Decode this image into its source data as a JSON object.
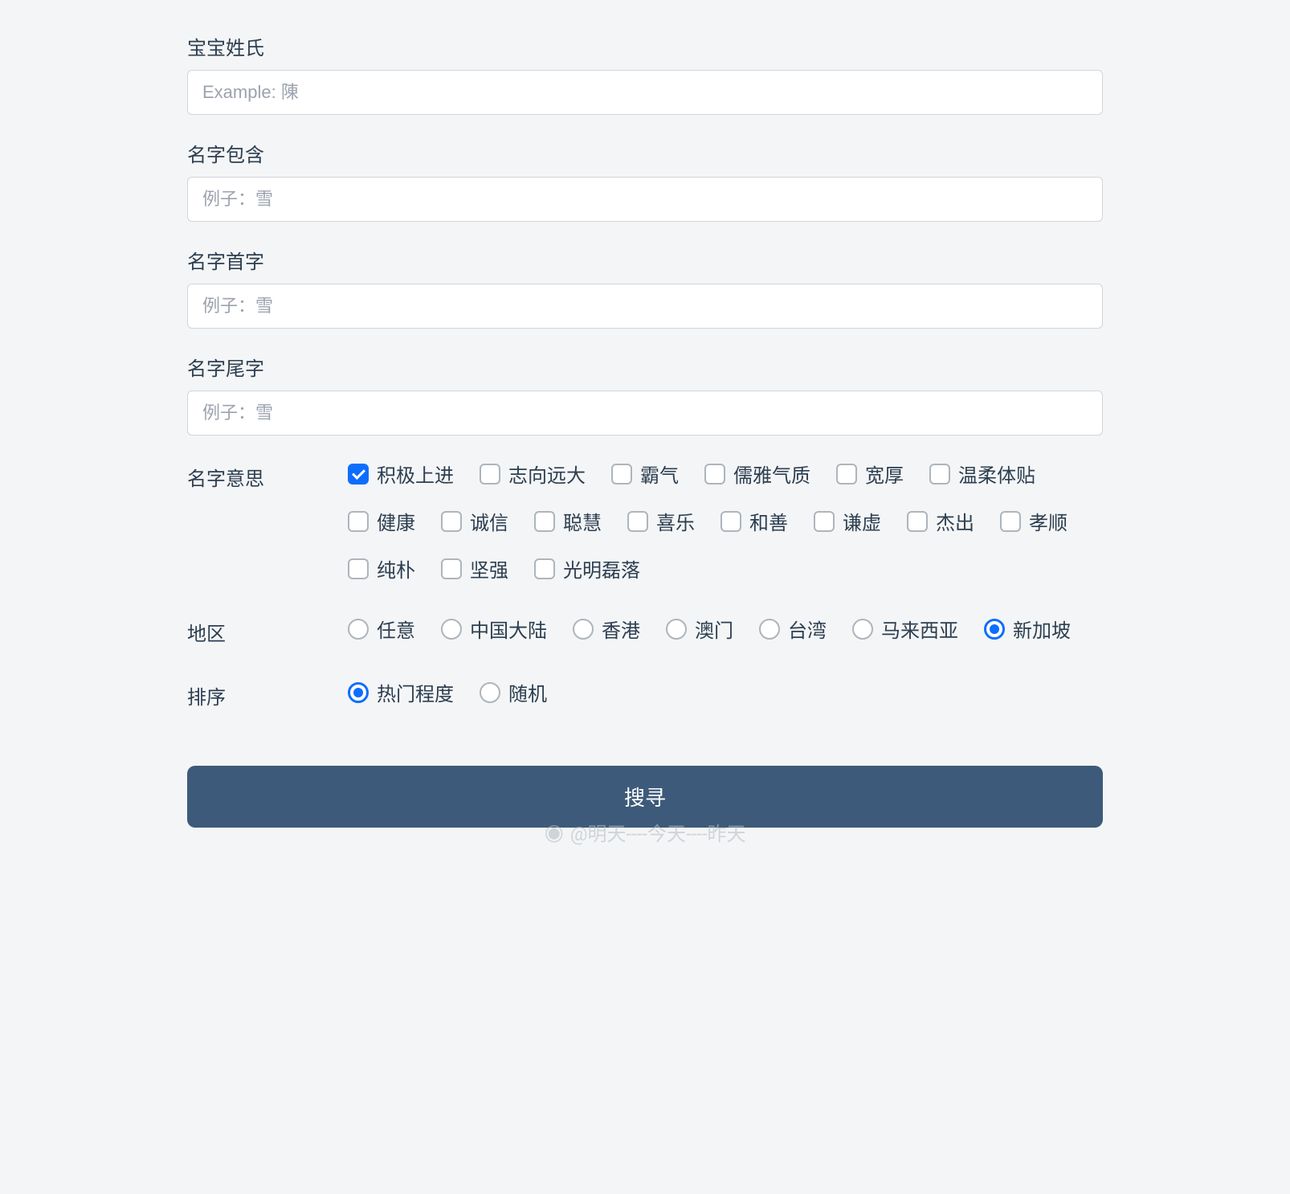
{
  "fields": {
    "surname": {
      "label": "宝宝姓氏",
      "placeholder": "Example: 陳",
      "value": ""
    },
    "contains": {
      "label": "名字包含",
      "placeholder": "例子：雪",
      "value": ""
    },
    "first_char": {
      "label": "名字首字",
      "placeholder": "例子：雪",
      "value": ""
    },
    "last_char": {
      "label": "名字尾字",
      "placeholder": "例子：雪",
      "value": ""
    }
  },
  "meaning": {
    "label": "名字意思",
    "options": [
      {
        "label": "积极上进",
        "checked": true
      },
      {
        "label": "志向远大",
        "checked": false
      },
      {
        "label": "霸气",
        "checked": false
      },
      {
        "label": "儒雅气质",
        "checked": false
      },
      {
        "label": "宽厚",
        "checked": false
      },
      {
        "label": "温柔体贴",
        "checked": false
      },
      {
        "label": "健康",
        "checked": false
      },
      {
        "label": "诚信",
        "checked": false
      },
      {
        "label": "聪慧",
        "checked": false
      },
      {
        "label": "喜乐",
        "checked": false
      },
      {
        "label": "和善",
        "checked": false
      },
      {
        "label": "谦虚",
        "checked": false
      },
      {
        "label": "杰出",
        "checked": false
      },
      {
        "label": "孝顺",
        "checked": false
      },
      {
        "label": "纯朴",
        "checked": false
      },
      {
        "label": "坚强",
        "checked": false
      },
      {
        "label": "光明磊落",
        "checked": false
      }
    ]
  },
  "region": {
    "label": "地区",
    "options": [
      {
        "label": "任意",
        "checked": false
      },
      {
        "label": "中国大陆",
        "checked": false
      },
      {
        "label": "香港",
        "checked": false
      },
      {
        "label": "澳门",
        "checked": false
      },
      {
        "label": "台湾",
        "checked": false
      },
      {
        "label": "马来西亚",
        "checked": false
      },
      {
        "label": "新加坡",
        "checked": true
      }
    ]
  },
  "sort": {
    "label": "排序",
    "options": [
      {
        "label": "热门程度",
        "checked": true
      },
      {
        "label": "随机",
        "checked": false
      }
    ]
  },
  "submit_label": "搜寻",
  "watermark": "@明天----今天----昨天"
}
